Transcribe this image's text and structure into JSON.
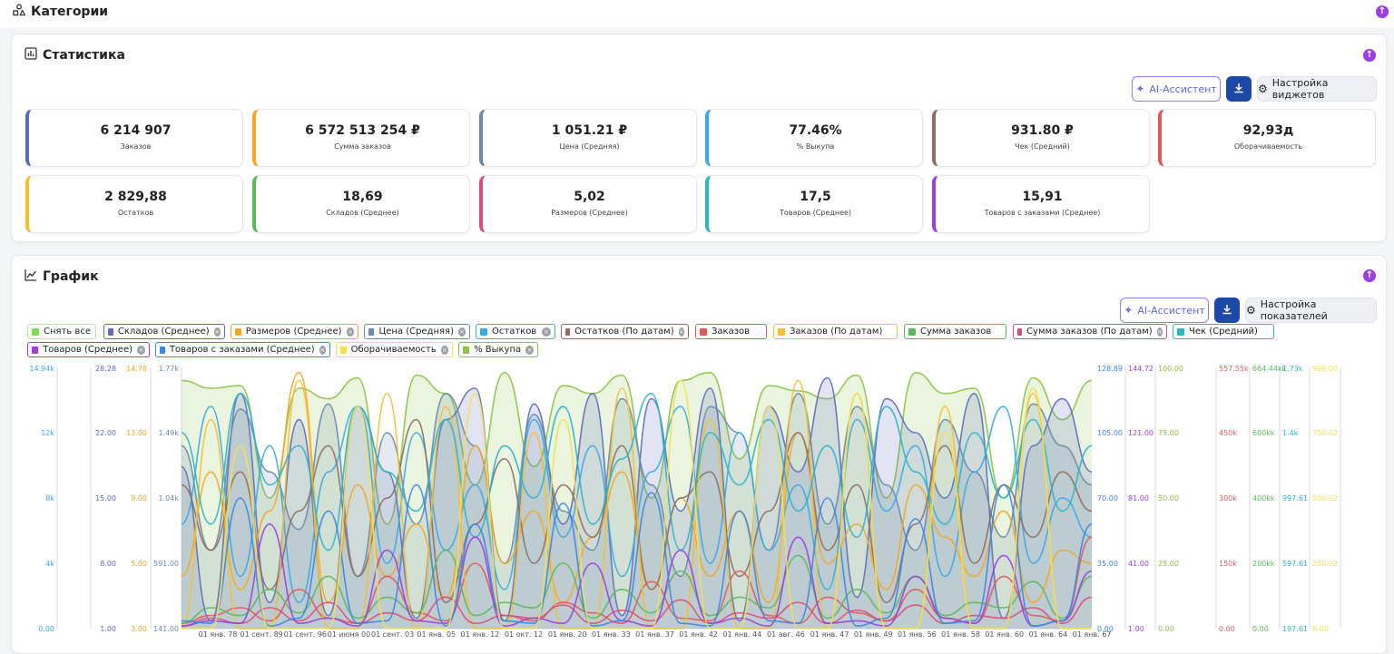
{
  "categories": {
    "title": "Категории"
  },
  "stats": {
    "title": "Статистика",
    "ai_label": "AI-Ассистент",
    "settings_label": "Настройка виджетов",
    "cards": [
      {
        "value": "6 214 907",
        "label": "Заказов",
        "color": "#5c6bc0"
      },
      {
        "value": "6 572 513 254 ₽",
        "label": "Сумма заказов",
        "color": "#f5a623"
      },
      {
        "value": "1 051.21 ₽",
        "label": "Цена (Средняя)",
        "color": "#6a8aa8"
      },
      {
        "value": "77.46%",
        "label": "% Выкупа",
        "color": "#3aa8e6"
      },
      {
        "value": "931.80 ₽",
        "label": "Чек (Средний)",
        "color": "#8d6e63"
      },
      {
        "value": "92,93д",
        "label": "Оборачиваемость",
        "color": "#e05a5a"
      },
      {
        "value": "2 829,88",
        "label": "Остатков",
        "color": "#f5c030"
      },
      {
        "value": "18,69",
        "label": "Складов (Среднее)",
        "color": "#5cb85c"
      },
      {
        "value": "5,02",
        "label": "Размеров (Среднее)",
        "color": "#d94f7a"
      },
      {
        "value": "17,5",
        "label": "Товаров (Среднее)",
        "color": "#2bb5c9"
      },
      {
        "value": "15,91",
        "label": "Товаров с заказами (Среднее)",
        "color": "#9b3fe0"
      }
    ]
  },
  "graph": {
    "title": "График",
    "ai_label": "AI-Ассистент",
    "settings_label": "Настройка показателей",
    "chips": [
      {
        "label": "Снять все",
        "color": "#7ed957",
        "border": "#b9e3a6",
        "closable": false
      },
      {
        "label": "Складов (Среднее)",
        "color": "#5c6bc0",
        "border": "#5c6bc0",
        "closable": true
      },
      {
        "label": "Размеров (Среднее)",
        "color": "#f5a623",
        "border": "#f5a623",
        "closable": true
      },
      {
        "label": "Цена (Средняя)",
        "color": "#6a8aa8",
        "border": "#6a8aa8",
        "closable": true
      },
      {
        "label": "Остатков",
        "color": "#3aa8e6",
        "border": "#3aa8e6",
        "closable": true
      },
      {
        "label": "Остатков (По датам)",
        "color": "#8d6e63",
        "border": "#8d6e63",
        "closable": true
      },
      {
        "label": "Заказов",
        "color": "#e05a5a",
        "border": "#e05a5a",
        "closable": false
      },
      {
        "label": "Заказов (По датам)",
        "color": "#f5c030",
        "border": "#f5c030",
        "closable": false
      },
      {
        "label": "Сумма заказов",
        "color": "#5cb85c",
        "border": "#5cb85c",
        "closable": false
      },
      {
        "label": "Сумма заказов (По датам)",
        "color": "#d94f7a",
        "border": "#d94f7a",
        "closable": true
      },
      {
        "label": "Чек (Средний)",
        "color": "#2bb5c9",
        "border": "#2bb5c9",
        "closable": false
      },
      {
        "label": "Товаров (Среднее)",
        "color": "#9b3fe0",
        "border": "#9b3fe0",
        "closable": true
      },
      {
        "label": "Товаров с заказами (Среднее)",
        "color": "#3a86e6",
        "border": "#3a86e6",
        "closable": true
      },
      {
        "label": "Оборачиваемость",
        "color": "#f5e050",
        "border": "#f5e050",
        "closable": true
      },
      {
        "label": "% Выкупа",
        "color": "#8bc34a",
        "border": "#8bc34a",
        "closable": true
      }
    ]
  },
  "chart_data": {
    "type": "line",
    "x": [
      "01 янв. 78",
      "01 сент. 89",
      "01 сент. 96",
      "01 июня 00",
      "01 сент. 03",
      "01 янв. 05",
      "01 янв. 12",
      "01 окт. 12",
      "01 янв. 20",
      "01 янв. 33",
      "01 янв. 37",
      "01 янв. 42",
      "01 янв. 44",
      "01 авг. 46",
      "01 янв. 47",
      "01 янв. 49",
      "01 янв. 56",
      "01 янв. 58",
      "01 янв. 60",
      "01 янв. 64",
      "01 янв. 67"
    ],
    "axes_left": [
      {
        "color": "#3aa8e6",
        "ticks": [
          "14.94k",
          "12k",
          "8k",
          "4k",
          "0.00"
        ]
      },
      {
        "color": "#5c6bc0",
        "ticks": [
          "28.28",
          "22.00",
          "15.00",
          "8.00",
          "1.00"
        ]
      },
      {
        "color": "#f5a623",
        "ticks": [
          "14.78",
          "13.00",
          "9.00",
          "5.00",
          "3.00"
        ]
      },
      {
        "color": "#6a8aa8",
        "ticks": [
          "1.77k",
          "1.49k",
          "1.04k",
          "591.00",
          "141.00"
        ]
      }
    ],
    "axes_right": [
      {
        "color": "#3a86e6",
        "ticks": [
          "128.89",
          "105.00",
          "70.00",
          "35.00",
          "0.00"
        ]
      },
      {
        "color": "#9b3fe0",
        "ticks": [
          "144.72",
          "121.00",
          "81.00",
          "41.00",
          "1.00"
        ]
      },
      {
        "color": "#8bc34a",
        "ticks": [
          "100.00",
          "75.00",
          "50.00",
          "25.00",
          "0.00"
        ]
      },
      {
        "color": "#e05a5a",
        "ticks": [
          "557.55k",
          "450k",
          "300k",
          "150k",
          "0.00"
        ]
      },
      {
        "color": "#5cb85c",
        "ticks": [
          "664.44kk",
          "600kk",
          "400kk",
          "200kk",
          "0.00"
        ]
      },
      {
        "color": "#2bb5c9",
        "ticks": [
          "1.73k",
          "1.4k",
          "997.61",
          "597.61",
          "197.61"
        ]
      },
      {
        "color": "#f5e050",
        "ticks": [
          "999.00",
          "750.02",
          "500.02",
          "250.02",
          "0.00"
        ]
      }
    ],
    "series": [
      {
        "name": "% Выкупа",
        "color": "#8bc34a",
        "fill": true,
        "values": [
          95,
          92,
          93,
          50,
          92,
          88,
          96,
          40,
          97,
          90,
          55,
          98,
          62,
          93,
          90,
          97,
          50,
          95,
          98,
          65,
          93,
          91,
          88,
          97,
          50,
          98,
          90,
          92,
          50,
          96,
          80,
          95
        ]
      },
      {
        "name": "Складов (Среднее)",
        "color": "#5c6bc0",
        "fill": true,
        "values": [
          62,
          3,
          90,
          10,
          80,
          5,
          85,
          60,
          4,
          80,
          92,
          3,
          86,
          40,
          90,
          5,
          88,
          45,
          92,
          3,
          85,
          60,
          96,
          12,
          88,
          75,
          50,
          90,
          4,
          70,
          88,
          60
        ]
      },
      {
        "name": "Цена (Средняя)",
        "color": "#6a8aa8",
        "fill": true,
        "values": [
          70,
          30,
          84,
          60,
          38,
          86,
          20,
          75,
          40,
          90,
          70,
          25,
          82,
          45,
          30,
          88,
          55,
          20,
          85,
          75,
          30,
          90,
          40,
          85,
          55,
          30,
          80,
          60,
          35,
          86,
          70,
          55
        ]
      },
      {
        "name": "Остатков",
        "color": "#3aa8e6",
        "fill": false,
        "values": [
          40,
          85,
          20,
          70,
          10,
          60,
          85,
          25,
          75,
          30,
          55,
          15,
          80,
          35,
          70,
          20,
          60,
          85,
          25,
          75,
          30,
          55,
          15,
          80,
          45,
          70,
          20,
          60,
          85,
          25,
          50,
          35
        ]
      },
      {
        "name": "Размеров (Среднее)",
        "color": "#f5a623",
        "fill": false,
        "values": [
          20,
          60,
          15,
          45,
          98,
          10,
          55,
          20,
          40,
          12,
          70,
          25,
          45,
          10,
          35,
          60,
          15,
          50,
          20,
          45,
          10,
          75,
          25,
          40,
          15,
          55,
          35,
          20,
          45,
          10,
          30,
          25
        ]
      },
      {
        "name": "Остатков (По датам)",
        "color": "#8d6e63",
        "fill": false,
        "values": [
          55,
          30,
          60,
          15,
          45,
          70,
          20,
          50,
          80,
          10,
          40,
          65,
          25,
          55,
          35,
          70,
          15,
          50,
          60,
          20,
          45,
          75,
          30,
          55,
          10,
          40,
          70,
          25,
          55,
          35,
          60,
          45
        ]
      },
      {
        "name": "Заказов",
        "color": "#e05a5a",
        "fill": false,
        "values": [
          2,
          5,
          8,
          3,
          15,
          4,
          2,
          20,
          6,
          3,
          25,
          5,
          3,
          10,
          6,
          2,
          18,
          4,
          3,
          22,
          5,
          2,
          12,
          6,
          3,
          15,
          4,
          2,
          20,
          5,
          3,
          35
        ]
      },
      {
        "name": "Заказов (По датам)",
        "color": "#f5c030",
        "fill": false,
        "values": [
          0,
          80,
          0,
          0,
          95,
          0,
          0,
          90,
          0,
          85,
          0,
          0,
          75,
          0,
          0,
          92,
          0,
          0,
          80,
          0,
          0,
          95,
          0,
          90,
          0,
          0,
          85,
          0,
          0,
          90,
          0,
          0
        ]
      },
      {
        "name": "Сумма заказов",
        "color": "#5cb85c",
        "fill": false,
        "values": [
          2,
          8,
          5,
          15,
          6,
          20,
          4,
          12,
          6,
          30,
          5,
          10,
          8,
          25,
          4,
          15,
          6,
          22,
          5,
          12,
          8,
          28,
          4,
          15,
          6,
          20,
          5,
          10,
          8,
          18,
          4,
          20
        ]
      },
      {
        "name": "Сумма заказов (По датам)",
        "color": "#d94f7a",
        "fill": false,
        "values": [
          1,
          4,
          2,
          8,
          3,
          10,
          2,
          6,
          3,
          12,
          2,
          5,
          4,
          9,
          2,
          7,
          3,
          11,
          2,
          6,
          4,
          10,
          2,
          7,
          3,
          9,
          2,
          5,
          4,
          8,
          2,
          12
        ]
      },
      {
        "name": "Чек (Средний)",
        "color": "#2bb5c9",
        "fill": false,
        "values": [
          75,
          40,
          90,
          55,
          70,
          30,
          85,
          60,
          45,
          80,
          35,
          70,
          50,
          85,
          40,
          65,
          90,
          30,
          75,
          55,
          80,
          45,
          70,
          35,
          85,
          60,
          40,
          75,
          50,
          80,
          45,
          70
        ]
      },
      {
        "name": "Товаров (Среднее)",
        "color": "#9b3fe0",
        "fill": false,
        "values": [
          1,
          3,
          2,
          40,
          2,
          4,
          1,
          30,
          3,
          2,
          35,
          1,
          4,
          2,
          25,
          3,
          1,
          30,
          2,
          4,
          1,
          35,
          2,
          3,
          1,
          20,
          4,
          2,
          28,
          1,
          3,
          22
        ]
      },
      {
        "name": "Товаров с заказами (Среднее)",
        "color": "#3a86e6",
        "fill": false,
        "values": [
          3,
          2,
          50,
          1,
          4,
          45,
          2,
          3,
          55,
          1,
          40,
          3,
          2,
          48,
          1,
          3,
          52,
          2,
          1,
          45,
          3,
          2,
          50,
          1,
          4,
          42,
          2,
          3,
          55,
          1,
          3,
          40
        ]
      },
      {
        "name": "Оборачиваемость",
        "color": "#f5e050",
        "fill": false,
        "values": [
          0,
          0,
          70,
          0,
          0,
          0,
          85,
          0,
          0,
          0,
          90,
          0,
          0,
          80,
          0,
          0,
          0,
          95,
          0,
          0,
          85,
          0,
          0,
          90,
          0,
          0,
          75,
          0,
          0,
          92,
          0,
          0
        ]
      }
    ]
  }
}
